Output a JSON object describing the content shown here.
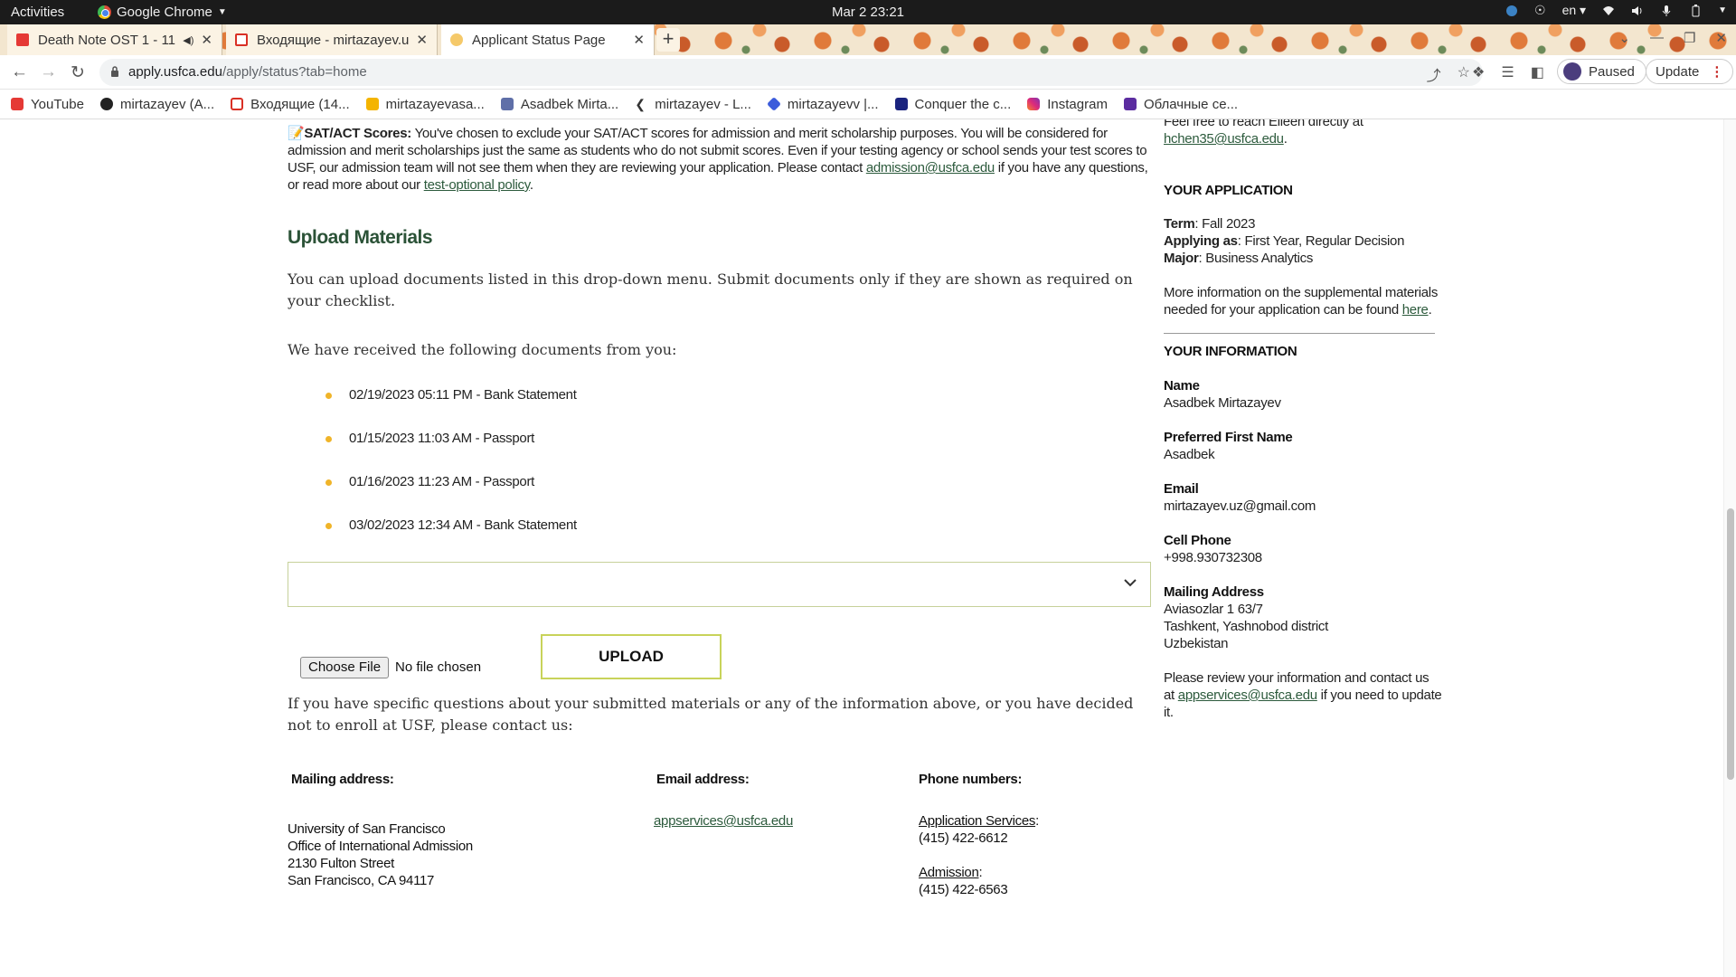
{
  "system": {
    "activities": "Activities",
    "app_name": "Google Chrome",
    "clock": "Mar 2  23:21",
    "lang": "en"
  },
  "tabs": [
    {
      "label": "Death Note OST 1 - 11",
      "favicon_color": "#e53935",
      "muted_icon": "speaker-icon"
    },
    {
      "label": "Входящие - mirtazayev.u",
      "favicon_color": "#d93025"
    },
    {
      "label": "Applicant Status Page",
      "favicon_color": "#f5c96a",
      "active": true
    }
  ],
  "toolbar": {
    "url_host": "apply.usfca.edu",
    "url_path": "/apply/status?tab=home",
    "profile_label": "Paused",
    "update_label": "Update"
  },
  "bookmarks": [
    {
      "label": "YouTube",
      "color": "#e53935"
    },
    {
      "label": "mirtazayev (A...",
      "color": "#222222"
    },
    {
      "label": "Входящие (14...",
      "color": "#d93025"
    },
    {
      "label": "mirtazayevasa...",
      "color": "#f4b400"
    },
    {
      "label": "Asadbek Mirta...",
      "color": "#5f6fa8"
    },
    {
      "label": "mirtazayev - L...",
      "color": "#333333"
    },
    {
      "label": "mirtazayevv |...",
      "color": "#3b5bdb"
    },
    {
      "label": "Conquer the c...",
      "color": "#1a237e"
    },
    {
      "label": "Instagram",
      "color": "#d6249f"
    },
    {
      "label": "Облачные се...",
      "color": "#5b2ca0"
    }
  ],
  "content": {
    "sat_title": "SAT/ACT Scores:",
    "sat_text_1": " You've chosen to exclude your SAT/ACT scores for admission and merit scholarship purposes. You will be considered for admission and merit scholarships just the same as students who do not submit scores. Even if your testing agency or school sends your test scores to USF, our admission team will not see them when they are reviewing your application. Please contact ",
    "sat_email": "admission@usfca.edu",
    "sat_text_2": " if you have any questions, or read more about our ",
    "sat_policy_link": "test-optional policy",
    "sat_text_3": ".",
    "upload_heading": "Upload Materials",
    "upload_text": "You can upload documents listed in this drop-down menu. Submit documents only if they are shown as required on your checklist.",
    "received_text": "We have received the following documents from you:",
    "documents": [
      "02/19/2023 05:11 PM - Bank Statement",
      "01/15/2023 11:03 AM - Passport",
      "01/16/2023 11:23 AM - Passport",
      "03/02/2023 12:34 AM - Bank Statement"
    ],
    "select_value": "",
    "choose_file_label": "Choose File",
    "no_file_text": "No file chosen",
    "upload_button": "UPLOAD",
    "questions_text": "If you have specific questions about your submitted materials or any of the information above, or you have decided not to enroll at USF, please contact us:",
    "mailing_heading": "Mailing address:",
    "mailing_lines": [
      "University of San Francisco",
      "Office of International Admission",
      "2130 Fulton Street",
      "San Francisco, CA 94117"
    ],
    "email_heading": "Email address:",
    "email_value": "appservices@usfca.edu",
    "phone_heading": "Phone numbers:",
    "phone_app_label": "Application Services",
    "phone_app_number": "(415) 422-6612",
    "phone_adm_label": "Admission",
    "phone_adm_number": "(415) 422-6563"
  },
  "sidebar": {
    "reach_text": "Feel free to reach Eileen directly at",
    "reach_email": "hchen35@usfca.edu",
    "app_heading": "YOUR APPLICATION",
    "term_label": "Term",
    "term_value": ": Fall 2023",
    "applying_label": "Applying as",
    "applying_value": ": First Year, Regular Decision",
    "major_label": "Major",
    "major_value": ": Business Analytics",
    "more_info_1": "More information on the supplemental materials",
    "more_info_2": "needed for your application can be found ",
    "more_info_link": "here",
    "info_heading": "YOUR INFORMATION",
    "name_label": "Name",
    "name_value": "Asadbek Mirtazayev",
    "pref_label": "Preferred First Name",
    "pref_value": "Asadbek",
    "email_label": "Email",
    "email_value": "mirtazayev.uz@gmail.com",
    "phone_label": "Cell Phone",
    "phone_value": "+998.930732308",
    "addr_label": "Mailing Address",
    "addr_lines": [
      "Aviasozlar 1 63/7",
      "Tashkent, Yashnobod district",
      "Uzbekistan"
    ],
    "review_1": "Please review your information and contact us",
    "review_2_pre": "at ",
    "review_email": "appservices@usfca.edu",
    "review_2_post": " if you need to update",
    "review_3": "it."
  }
}
